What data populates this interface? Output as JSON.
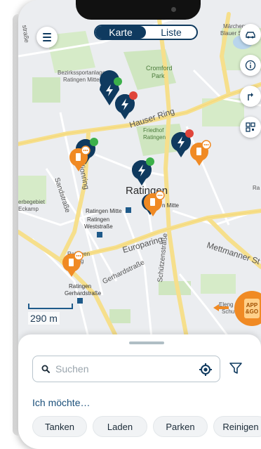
{
  "header": {
    "toggle_map": "Karte",
    "toggle_list": "Liste"
  },
  "map": {
    "labels": {
      "cromford_park": [
        "Cromford",
        "Park"
      ],
      "sportanlage": [
        "Bezirkssportanlage",
        "Ratingen Mitte"
      ],
      "hauser_ring": "Hauser Ring",
      "friedhof": [
        "Friedhof",
        "Ratingen"
      ],
      "city": "Ratingen",
      "ratingen_mitte": "Ratingen Mitte",
      "ratingen_weststrasse": [
        "Ratingen",
        "Weststraße"
      ],
      "europaring": "Europaring",
      "schuetzenstrasse": "Schützenstraße",
      "gerhardstrasse": "Gerhardstraße",
      "mettmanner": "Mettmanner St",
      "ratingen_gerhardstrasse": [
        "Ratingen",
        "Gerhardstraße"
      ],
      "sandstrasse": "Sandstraße",
      "gewerbegebiet": [
        "erbegebiet",
        "Eckamp"
      ],
      "dionring": "dionring",
      "strasse_left": "straße",
      "maerchenzoo": [
        "Märchenzo",
        "Blauer Se"
      ],
      "mitte_partial": "n Mitte",
      "ratingen_sing": [
        "Ratingen",
        "ring"
      ],
      "eleng": [
        "Eleng",
        "Schu"
      ],
      "ra_right": "Ra"
    },
    "scale_label": "290 m"
  },
  "badge": {
    "text_line1": "APP",
    "text_line2": "&GO"
  },
  "sheet": {
    "search_placeholder": "Suchen",
    "prompt": "Ich möchte…",
    "chips": [
      "Tanken",
      "Laden",
      "Parken",
      "Reinigen"
    ]
  },
  "colors": {
    "brand_dark": "#0f3a5f",
    "charging_pin": "#0f3a5f",
    "fuel_pin": "#f08a24",
    "status_green": "#3cb04a",
    "status_red": "#e0453a"
  }
}
